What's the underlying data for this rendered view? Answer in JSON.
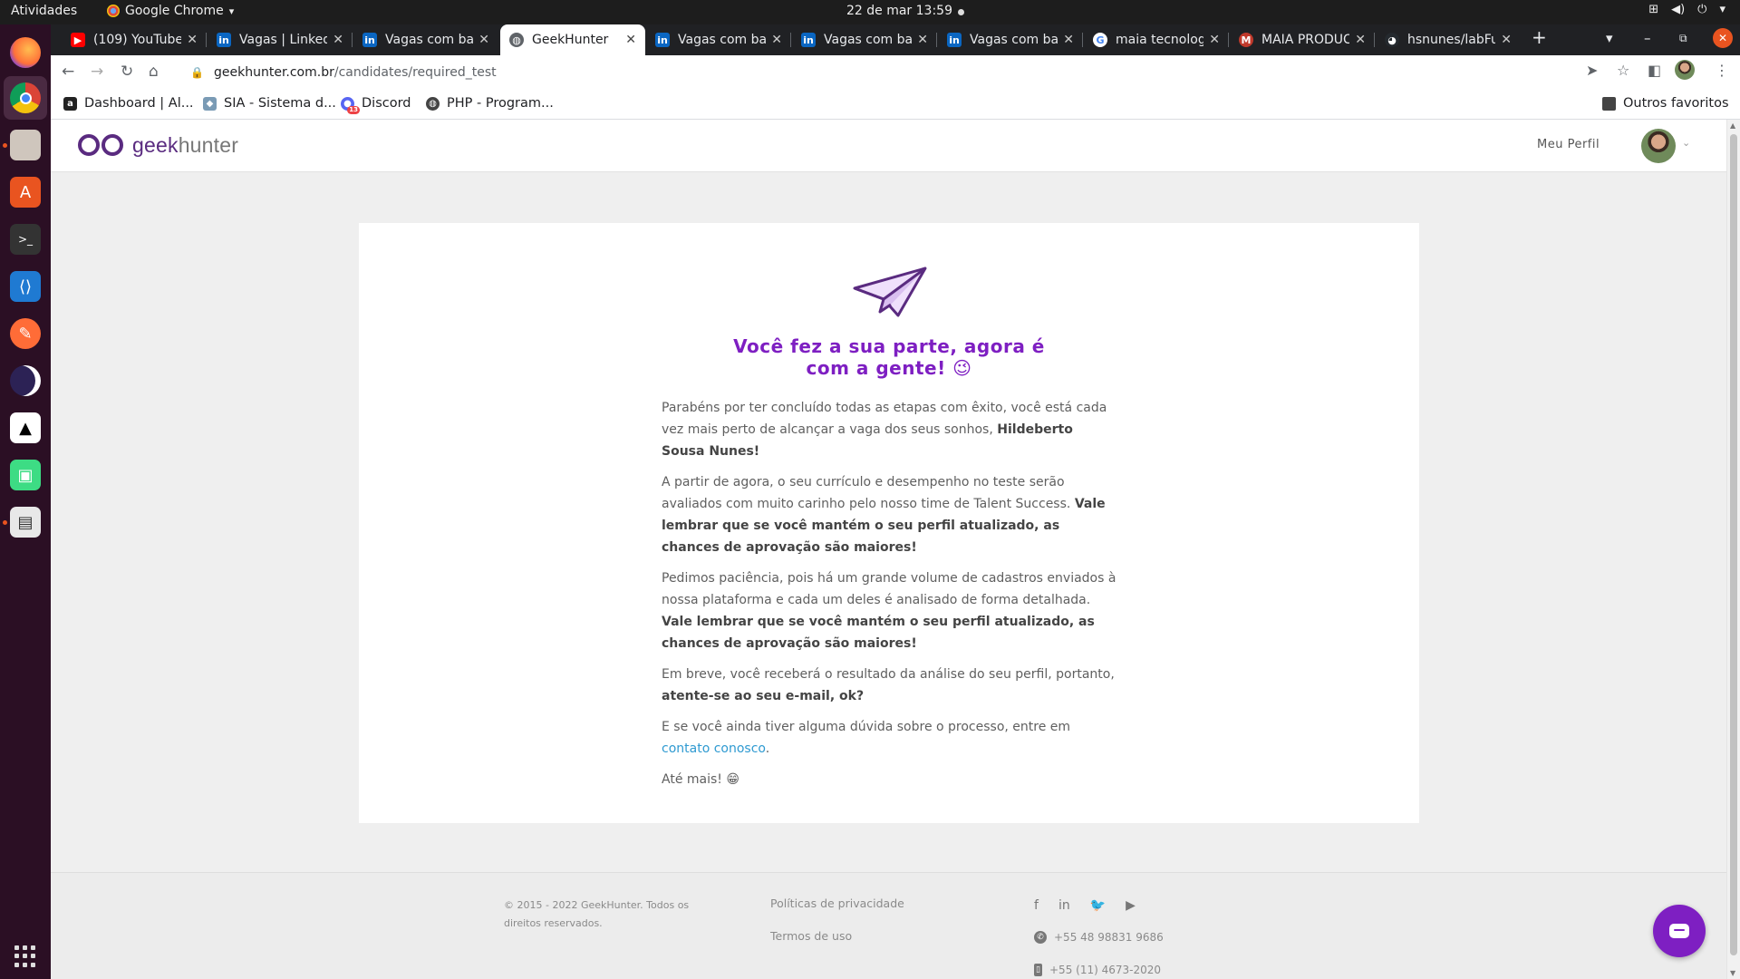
{
  "os_bar": {
    "activities": "Atividades",
    "app_name": "Google Chrome",
    "app_menu_arrow": "▾",
    "clock": "22 de mar  13:59",
    "system_icons": [
      "network-icon",
      "volume-icon",
      "power-icon",
      "chevron-down-icon"
    ]
  },
  "dock": {
    "apps": [
      "firefox-icon",
      "chrome-icon",
      "files-icon",
      "app-center-icon",
      "terminal-icon",
      "vscode-icon",
      "postman-icon",
      "eclipse-icon",
      "inkscape-icon",
      "android-studio-icon",
      "document-viewer-icon"
    ],
    "show_apps_icon": "grid-icon"
  },
  "browser": {
    "tabs": [
      {
        "label": "(109) YouTube",
        "icon": "youtube-icon",
        "color": "#ff0000"
      },
      {
        "label": "Vagas | LinkedIn",
        "icon": "linkedin-icon",
        "color": "#0a66c2"
      },
      {
        "label": "Vagas com base",
        "icon": "linkedin-icon",
        "color": "#0a66c2"
      },
      {
        "label": "GeekHunter",
        "icon": "globe-icon",
        "color": "#5f6368",
        "active": true
      },
      {
        "label": "Vagas com base",
        "icon": "linkedin-icon",
        "color": "#0a66c2"
      },
      {
        "label": "Vagas com base",
        "icon": "linkedin-icon",
        "color": "#0a66c2"
      },
      {
        "label": "Vagas com base",
        "icon": "linkedin-icon",
        "color": "#0a66c2"
      },
      {
        "label": "maia tecnologia",
        "icon": "google-icon",
        "color": "#4285f4"
      },
      {
        "label": "MAIA PRODUCT",
        "icon": "maia-icon",
        "color": "#c0392b"
      },
      {
        "label": "hsnunes/labFull",
        "icon": "github-icon",
        "color": "#24292e"
      }
    ],
    "new_tab": "+",
    "tab_close": "✕",
    "url_domain": "geekhunter.com.br",
    "url_path": "/candidates/required_test",
    "bookmarks": [
      {
        "label": "Dashboard | Al...",
        "icon": "dashboard-bookmark-icon",
        "color": "#222222"
      },
      {
        "label": "SIA - Sistema d...",
        "icon": "sia-bookmark-icon",
        "color": "#7a9bb5"
      },
      {
        "label": "Discord",
        "icon": "discord-bookmark-icon",
        "color": "#5865f2",
        "badge": "13"
      },
      {
        "label": "PHP - Program...",
        "icon": "globe-icon",
        "color": "#444444"
      }
    ],
    "other_bookmarks": "Outros favoritos"
  },
  "site": {
    "logo_geek": "geek",
    "logo_hunter": "hunter",
    "my_profile": "Meu Perfil",
    "brand_color": "#7e1fc2",
    "headline": "Você fez a sua parte, agora é com a gente! 😉",
    "p1_a": "Parabéns por ter concluído todas as etapas com êxito, você está cada vez mais perto de alcançar a vaga dos seus sonhos, ",
    "p1_name": "Hildeberto Sousa Nunes!",
    "p2_a": "A partir de agora, o seu currículo e desempenho no teste serão avaliados com muito carinho pelo nosso time de Talent Success. ",
    "p2_b": "Vale lembrar que se você mantém o seu perfil atualizado, as chances de aprovação são maiores!",
    "p3_a": "Pedimos paciência, pois há um grande volume de cadastros enviados à nossa plataforma e cada um deles é analisado de forma detalhada. ",
    "p3_b": "Vale lembrar que se você mantém o seu perfil atualizado, as chances de aprovação são maiores!",
    "p4_a": "Em breve, você receberá o resultado da análise do seu perfil, portanto, ",
    "p4_b": "atente-se ao seu e-mail, ok?",
    "p5_a": "E se você ainda tiver alguma dúvida sobre o processo, entre em ",
    "p5_link": "contato conosco",
    "p5_end": ".",
    "p6": "Até mais! 😁"
  },
  "footer": {
    "copyright": "© 2015 - 2022 GeekHunter. Todos os direitos reservados.",
    "privacy": "Políticas de privacidade",
    "terms": "Termos de uso",
    "social": [
      "facebook-icon",
      "linkedin-icon",
      "twitter-icon",
      "youtube-icon"
    ],
    "phone_whatsapp": "+55 48 98831 9686",
    "phone_landline": "+55 (11) 4673-2020"
  }
}
